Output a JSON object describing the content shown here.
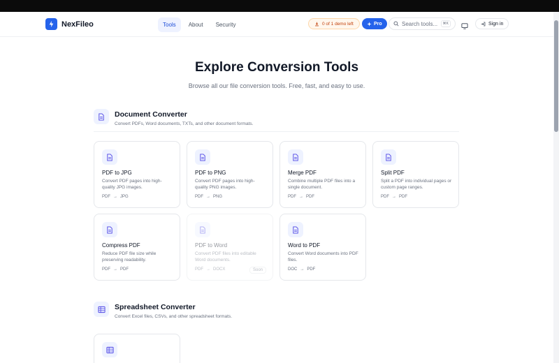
{
  "header": {
    "brand": "NexFileo",
    "nav": [
      {
        "label": "Tools",
        "active": true
      },
      {
        "label": "About",
        "active": false
      },
      {
        "label": "Security",
        "active": false
      }
    ],
    "demo_pill": "0 of 1 demo left",
    "pro_label": "Pro",
    "search_placeholder": "Search tools...",
    "search_shortcut": "⌘K",
    "signin_label": "Sign in"
  },
  "hero": {
    "title": "Explore Conversion Tools",
    "subtitle": "Browse all our file conversion tools. Free, fast, and easy to use."
  },
  "sections": [
    {
      "title": "Document Converter",
      "desc": "Convert PDFs, Word documents, TXTs, and other document formats.",
      "icon": "document-icon",
      "tools": [
        {
          "title": "PDF to JPG",
          "desc": "Convert PDF pages into high-quality JPG images.",
          "from": "PDF",
          "to": "JPG",
          "soon": false
        },
        {
          "title": "PDF to PNG",
          "desc": "Convert PDF pages into high-quality PNG images.",
          "from": "PDF",
          "to": "PNG",
          "soon": false
        },
        {
          "title": "Merge PDF",
          "desc": "Combine multiple PDF files into a single document.",
          "from": "PDF",
          "to": "PDF",
          "soon": false
        },
        {
          "title": "Split PDF",
          "desc": "Split a PDF into individual pages or custom page ranges.",
          "from": "PDF",
          "to": "PDF",
          "soon": false
        },
        {
          "title": "Compress PDF",
          "desc": "Reduce PDF file size while preserving readability.",
          "from": "PDF",
          "to": "PDF",
          "soon": false
        },
        {
          "title": "PDF to Word",
          "desc": "Convert PDF files into editable Word documents.",
          "from": "PDF",
          "to": "DOCX",
          "soon": true,
          "soon_label": "Soon"
        },
        {
          "title": "Word to PDF",
          "desc": "Convert Word documents into PDF files.",
          "from": "DOC",
          "to": "PDF",
          "soon": false
        }
      ]
    },
    {
      "title": "Spreadsheet Converter",
      "desc": "Convert Excel files, CSVs, and other spreadsheet formats.",
      "icon": "spreadsheet-icon"
    }
  ],
  "colors": {
    "accent": "#2563eb",
    "demo": "#c2410c"
  }
}
